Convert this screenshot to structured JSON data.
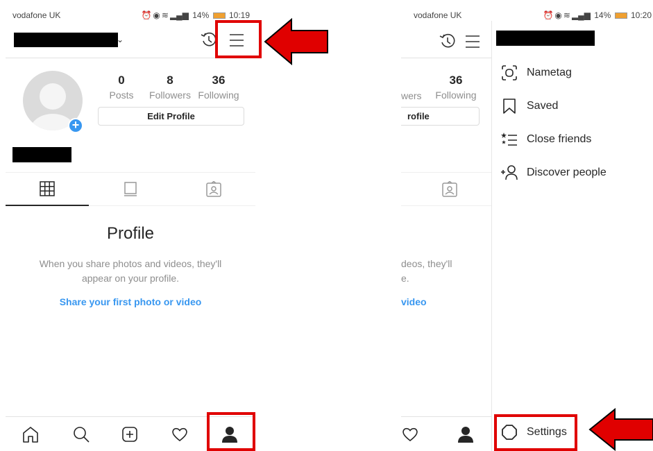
{
  "left": {
    "status": {
      "carrier": "vodafone UK",
      "battery": "14%",
      "time": "10:19"
    },
    "stats": [
      {
        "num": "0",
        "label": "Posts"
      },
      {
        "num": "8",
        "label": "Followers"
      },
      {
        "num": "36",
        "label": "Following"
      }
    ],
    "edit_profile": "Edit Profile",
    "empty": {
      "title": "Profile",
      "line1": "When you share photos and videos, they'll",
      "line2": "appear on your profile.",
      "link": "Share your first photo or video"
    }
  },
  "right": {
    "status": {
      "carrier": "vodafone UK",
      "battery": "14%",
      "time": "10:20"
    },
    "stats": {
      "num": "36",
      "label_partial": "wers",
      "label": "Following"
    },
    "edit_profile_partial": "rofile",
    "empty": {
      "line1_partial": "deos, they'll",
      "line2_partial": "e.",
      "link_partial": "video"
    },
    "menu": [
      {
        "label": "Nametag",
        "icon": "nametag-icon"
      },
      {
        "label": "Saved",
        "icon": "bookmark-icon"
      },
      {
        "label": "Close friends",
        "icon": "close-friends-icon"
      },
      {
        "label": "Discover people",
        "icon": "discover-people-icon"
      }
    ],
    "settings": "Settings"
  },
  "colors": {
    "accent": "#3897f0",
    "highlight": "#e00000",
    "text": "#262626",
    "muted": "#8e8e8e"
  }
}
